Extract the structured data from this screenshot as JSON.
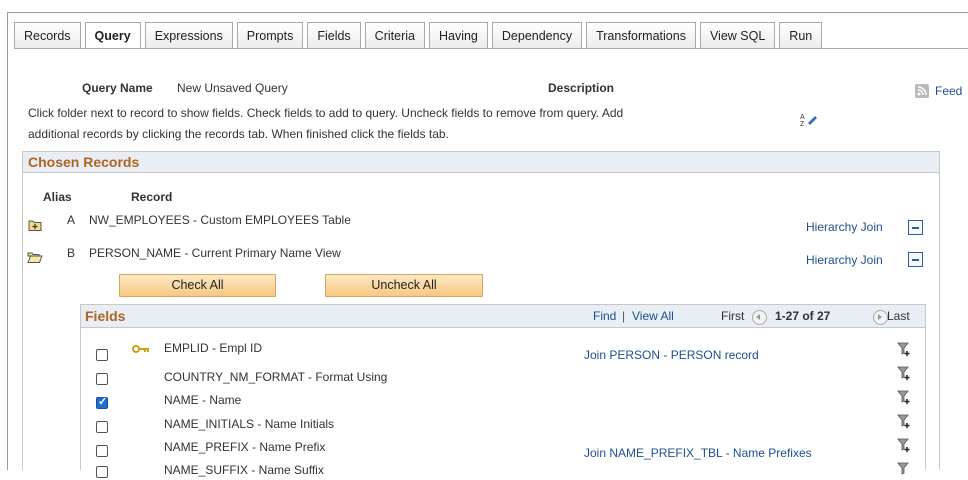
{
  "tabs": [
    {
      "label": "Records",
      "active": false
    },
    {
      "label": "Query",
      "active": true
    },
    {
      "label": "Expressions",
      "active": false
    },
    {
      "label": "Prompts",
      "active": false
    },
    {
      "label": "Fields",
      "active": false
    },
    {
      "label": "Criteria",
      "active": false
    },
    {
      "label": "Having",
      "active": false
    },
    {
      "label": "Dependency",
      "active": false
    },
    {
      "label": "Transformations",
      "active": false
    },
    {
      "label": "View SQL",
      "active": false
    },
    {
      "label": "Run",
      "active": false
    }
  ],
  "header": {
    "query_name_label": "Query Name",
    "query_name_value": "New Unsaved Query",
    "description_label": "Description",
    "feed_label": "Feed"
  },
  "instructions": {
    "line1": "Click folder next to record to show fields. Check fields to add to query. Uncheck fields to remove from query. Add",
    "line2": "additional records by clicking the records tab. When finished click the fields tab."
  },
  "chosen_records": {
    "title": "Chosen Records",
    "alias_header": "Alias",
    "record_header": "Record",
    "records": [
      {
        "alias": "A",
        "name": "NW_EMPLOYEES - Custom EMPLOYEES Table",
        "join_label": "Hierarchy Join",
        "folder": "closed"
      },
      {
        "alias": "B",
        "name": "PERSON_NAME - Current Primary Name View",
        "join_label": "Hierarchy Join",
        "folder": "open"
      }
    ],
    "check_all_label": "Check All",
    "uncheck_all_label": "Uncheck All"
  },
  "fields_grid": {
    "title": "Fields",
    "find_label": "Find",
    "view_all_label": "View All",
    "first_label": "First",
    "range_label": "1-27 of 27",
    "last_label": "Last",
    "rows": [
      {
        "name": "EMPLID - Empl ID",
        "checked": false,
        "key": true,
        "join": "Join PERSON - PERSON record"
      },
      {
        "name": "COUNTRY_NM_FORMAT - Format Using",
        "checked": false,
        "key": false,
        "join": ""
      },
      {
        "name": "NAME - Name",
        "checked": true,
        "key": false,
        "join": ""
      },
      {
        "name": "NAME_INITIALS - Name Initials",
        "checked": false,
        "key": false,
        "join": ""
      },
      {
        "name": "NAME_PREFIX - Name Prefix",
        "checked": false,
        "key": false,
        "join": "Join NAME_PREFIX_TBL - Name Prefixes"
      },
      {
        "name": "NAME_SUFFIX - Name Suffix",
        "checked": false,
        "key": false,
        "join": ""
      }
    ]
  }
}
